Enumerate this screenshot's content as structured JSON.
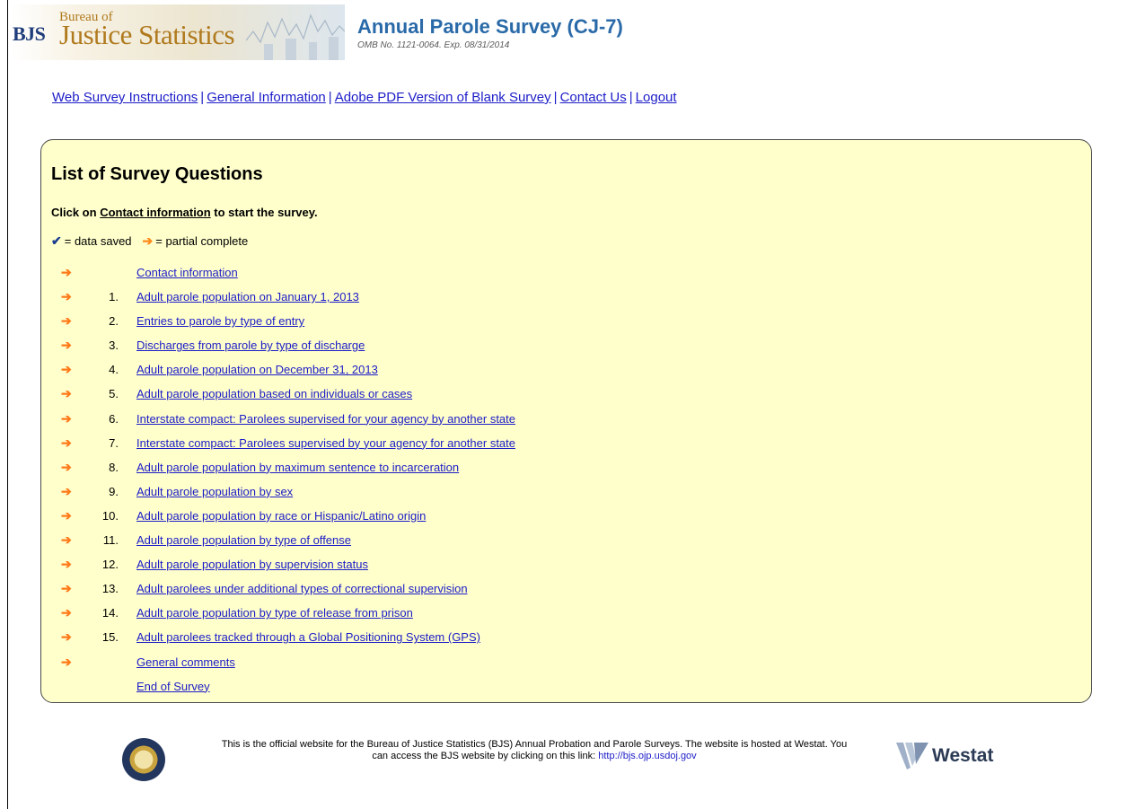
{
  "header": {
    "logo_abbr": "BJS",
    "logo_line1": "Bureau of",
    "logo_line2": "Justice Statistics",
    "title": "Annual Parole Survey (CJ-7)",
    "omb": "OMB No. 1121-0064. Exp. 08/31/2014"
  },
  "nav": {
    "items": [
      {
        "label": "Web Survey Instructions"
      },
      {
        "label": "General Information"
      },
      {
        "label": "Adobe PDF Version of Blank Survey"
      },
      {
        "label": "Contact Us"
      },
      {
        "label": "Logout"
      }
    ],
    "separator": "|"
  },
  "panel": {
    "title": "List of Survey Questions",
    "instruction_prefix": "Click on ",
    "instruction_link": "Contact information",
    "instruction_suffix": " to start the survey.",
    "legend": {
      "saved_symbol": "✔",
      "saved_label": "= data saved",
      "partial_symbol": "➔",
      "partial_label": "= partial complete"
    },
    "questions": [
      {
        "status": "partial",
        "num": "",
        "label": "Contact information"
      },
      {
        "status": "partial",
        "num": "1.",
        "label": "Adult parole population on January 1, 2013"
      },
      {
        "status": "partial",
        "num": "2.",
        "label": "Entries to parole by type of entry"
      },
      {
        "status": "partial",
        "num": "3.",
        "label": "Discharges from parole by type of discharge"
      },
      {
        "status": "partial",
        "num": "4.",
        "label": "Adult parole population on December 31, 2013"
      },
      {
        "status": "partial",
        "num": "5.",
        "label": "Adult parole population based on individuals or cases"
      },
      {
        "status": "partial",
        "num": "6.",
        "label": "Interstate compact: Parolees supervised for your agency by another state"
      },
      {
        "status": "partial",
        "num": "7.",
        "label": "Interstate compact: Parolees supervised by your agency for another state"
      },
      {
        "status": "partial",
        "num": "8.",
        "label": "Adult parole population by maximum sentence to incarceration"
      },
      {
        "status": "partial",
        "num": "9.",
        "label": "Adult parole population by sex"
      },
      {
        "status": "partial",
        "num": "10.",
        "label": "Adult parole population by race or Hispanic/Latino origin"
      },
      {
        "status": "partial",
        "num": "11.",
        "label": "Adult parole population by type of offense"
      },
      {
        "status": "partial",
        "num": "12.",
        "label": "Adult parole population by supervision status"
      },
      {
        "status": "partial",
        "num": "13.",
        "label": "Adult parolees under additional types of correctional supervision"
      },
      {
        "status": "partial",
        "num": "14.",
        "label": "Adult parole population by type of release from prison"
      },
      {
        "status": "partial",
        "num": "15.",
        "label": "Adult parolees tracked through a Global Positioning System (GPS)"
      },
      {
        "status": "partial",
        "num": "",
        "label": "General comments"
      },
      {
        "status": "none",
        "num": "",
        "label": "End of Survey"
      }
    ]
  },
  "footer": {
    "text_line1": "This is the official website for the Bureau of Justice Statistics (BJS) Annual Probation and Parole Surveys. The website is hosted at Westat. You",
    "text_line2": "can access the BJS website by clicking on this link: ",
    "link": "http://bjs.ojp.usdoj.gov",
    "westat": "Westat"
  },
  "colors": {
    "panel_bg": "#ffffcc",
    "link": "#1c1cc8",
    "partial_arrow": "#ff7a1a",
    "saved_check": "#1a3d8f",
    "title_blue": "#2a6aa8"
  }
}
